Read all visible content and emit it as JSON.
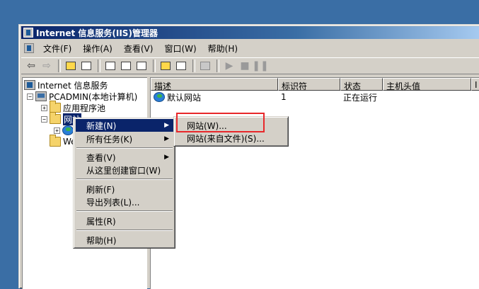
{
  "window": {
    "title": "Internet 信息服务(IIS)管理器"
  },
  "menu": [
    "文件(F)",
    "操作(A)",
    "查看(V)",
    "窗口(W)",
    "帮助(H)"
  ],
  "tree": {
    "root": "Internet 信息服务",
    "computer": "PCADMIN(本地计算机)",
    "app_pools": "应用程序池",
    "websites": "网站",
    "web_ext": "We"
  },
  "list": {
    "columns": [
      "描述",
      "标识符",
      "状态",
      "主机头值",
      "I"
    ],
    "rows": [
      {
        "name": "默认网站",
        "id": "1",
        "status": "正在运行",
        "host": "",
        "ip": ""
      }
    ]
  },
  "context_menu": {
    "items": [
      "新建(N)",
      "所有任务(K)",
      "查看(V)",
      "从这里创建窗口(W)",
      "刷新(F)",
      "导出列表(L)...",
      "属性(R)",
      "帮助(H)"
    ],
    "submenu": [
      "网站(W)...",
      "网站(来自文件)(S)..."
    ]
  },
  "colors": {
    "desktop": "#3a6ea5",
    "selection": "#0a246a",
    "annotation": "#e8282b"
  }
}
